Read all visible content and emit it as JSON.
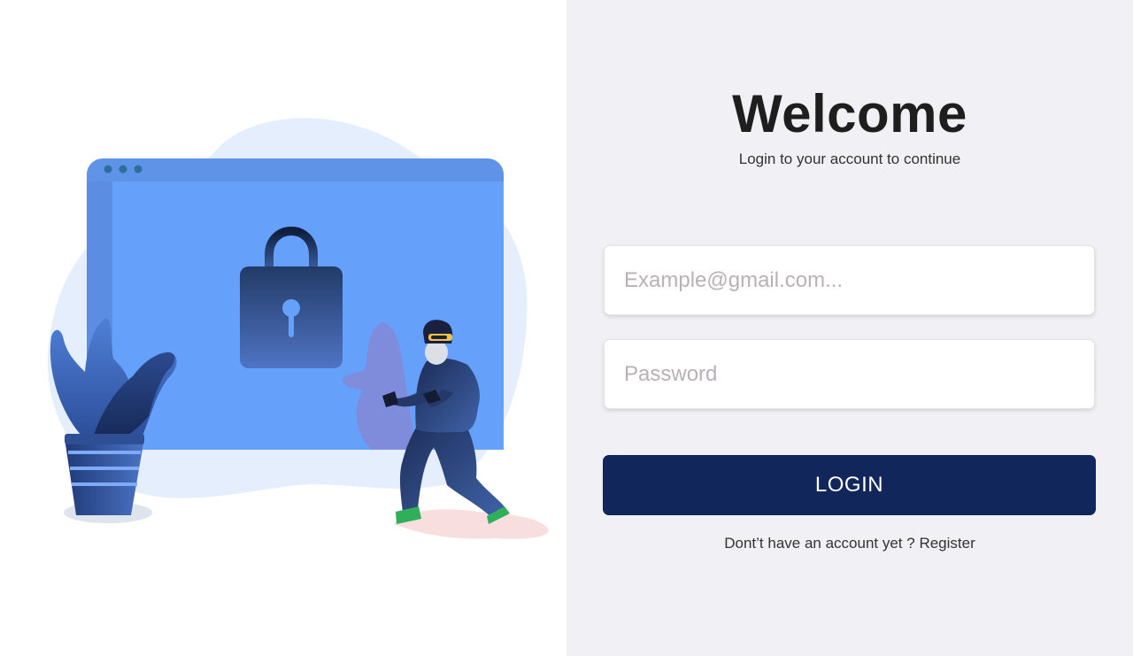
{
  "login": {
    "title": "Welcome",
    "subtitle": "Login to your account to continue",
    "email_placeholder": "Example@gmail.com...",
    "password_placeholder": "Password",
    "email_value": "",
    "password_value": "",
    "login_button_label": "LOGIN",
    "register_prompt": "Dont’t have an account yet ? ",
    "register_link_label": "Register"
  },
  "colors": {
    "left_background": "#ffffff",
    "right_background": "#f0f0f5",
    "button": "#11265a",
    "illustration_blue": "#65a0fb"
  },
  "illustration": {
    "icons": [
      "browser-window-icon",
      "padlock-icon",
      "plant-icon",
      "thief-icon"
    ]
  }
}
